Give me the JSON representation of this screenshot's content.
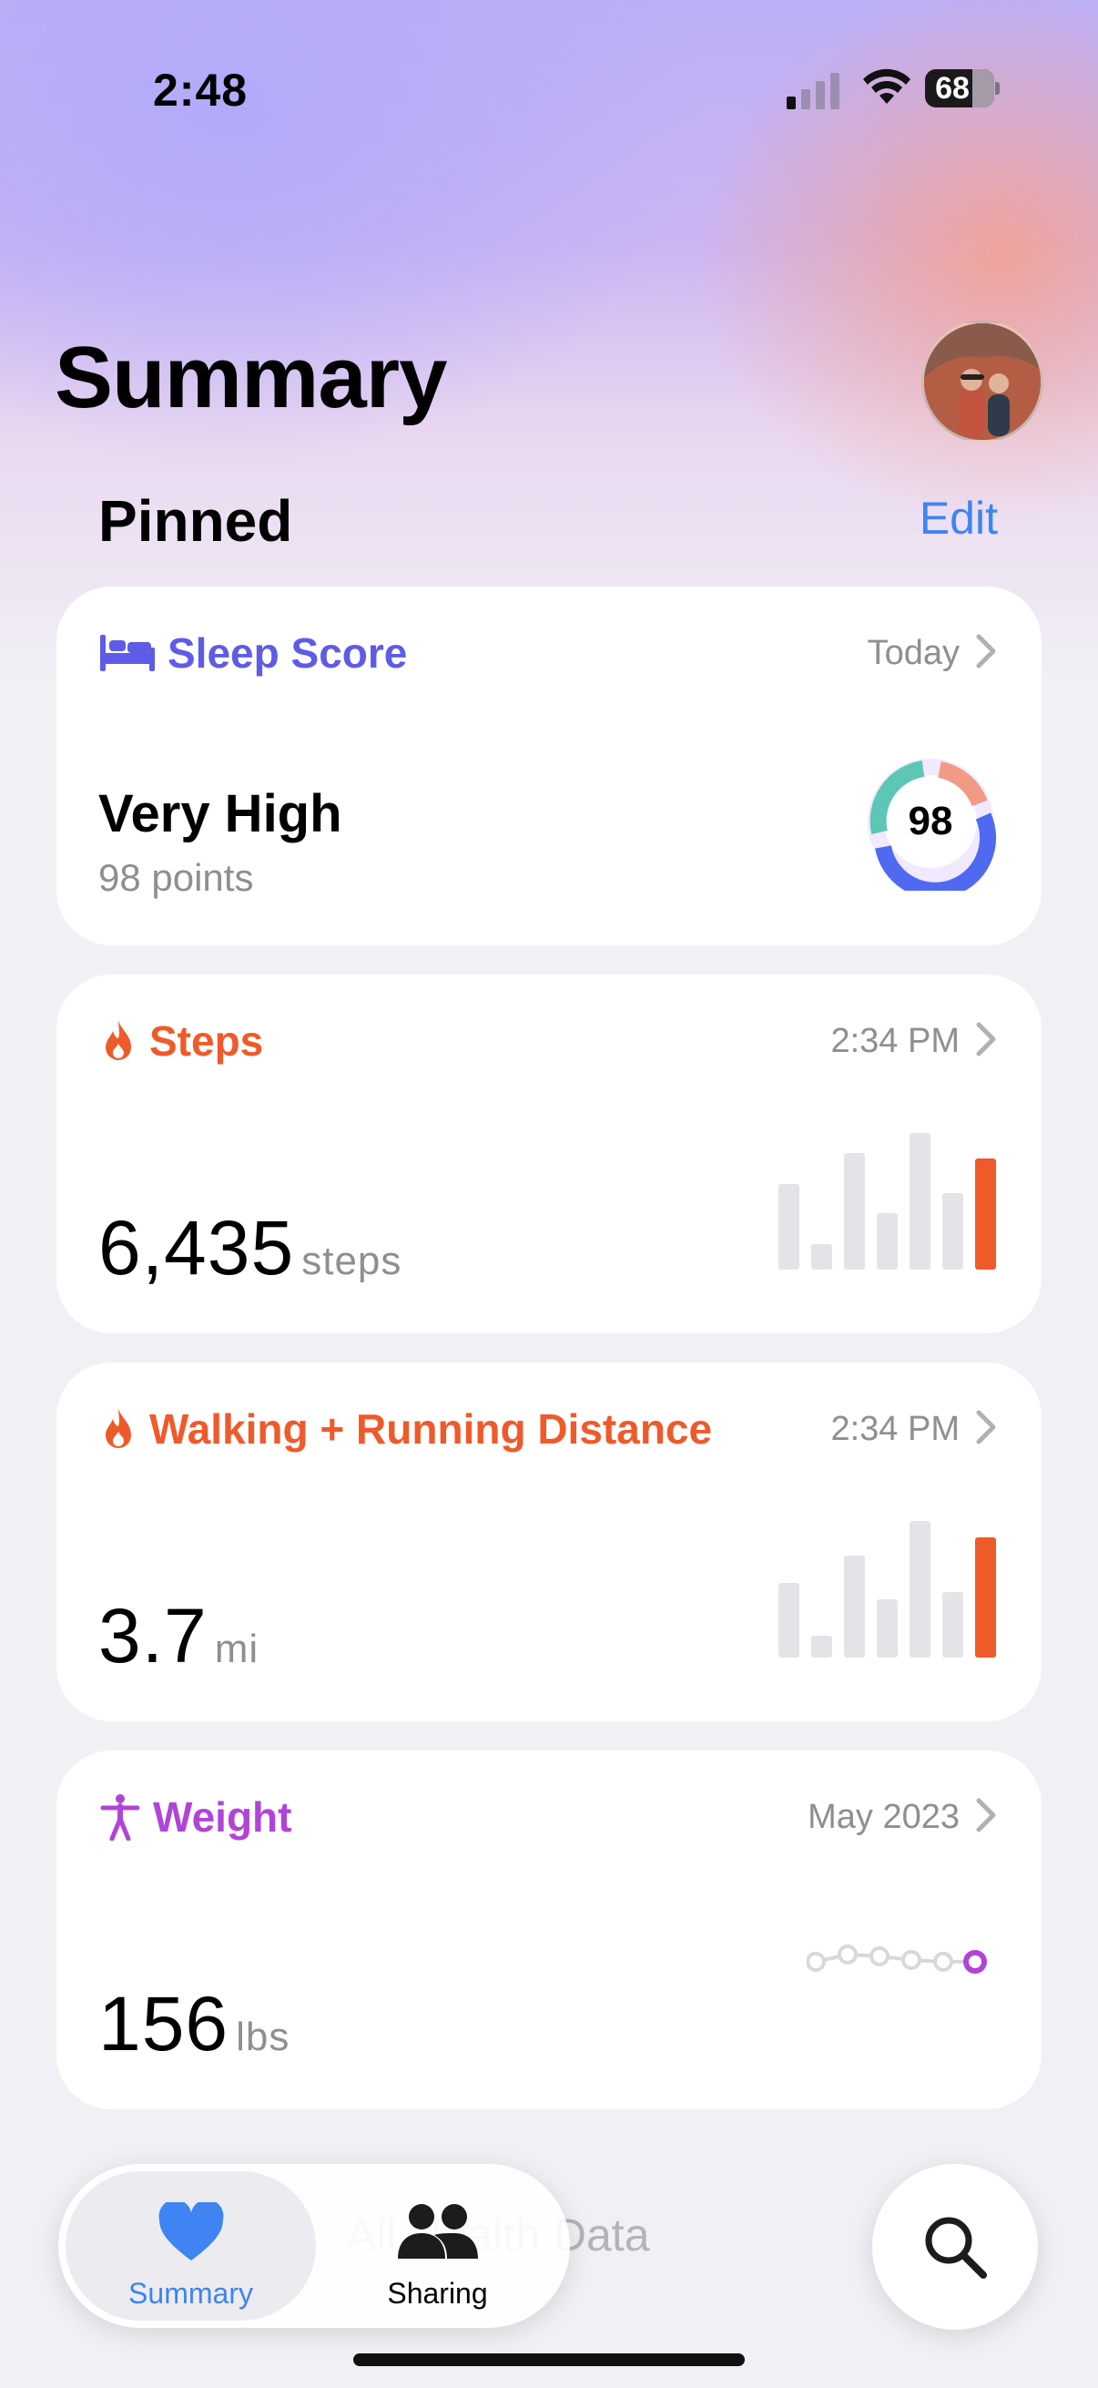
{
  "status": {
    "time": "2:48",
    "battery": "68"
  },
  "header": {
    "title": "Summary",
    "avatar_icon": "profile-photo"
  },
  "pinned": {
    "title": "Pinned",
    "edit_label": "Edit"
  },
  "cards": {
    "sleep": {
      "title": "Sleep Score",
      "meta": "Today",
      "value": "Very High",
      "sub": "98 points",
      "score": "98",
      "icon": "bed-icon",
      "color": "#5e5ce6"
    },
    "steps": {
      "title": "Steps",
      "meta": "2:34 PM",
      "value": "6,435",
      "unit": "steps",
      "icon": "flame-icon",
      "color": "#ef5a2a"
    },
    "distance": {
      "title": "Walking + Running Distance",
      "meta": "2:34 PM",
      "value": "3.7",
      "unit": "mi",
      "icon": "flame-icon",
      "color": "#ef5a2a"
    },
    "weight": {
      "title": "Weight",
      "meta": "May 2023",
      "value": "156",
      "unit": "lbs",
      "icon": "figure-icon",
      "color": "#b144d8"
    }
  },
  "tabbar": {
    "summary_label": "Summary",
    "sharing_label": "Sharing",
    "ghost_text": "All Health Data"
  },
  "accent": "#3f84f2"
}
